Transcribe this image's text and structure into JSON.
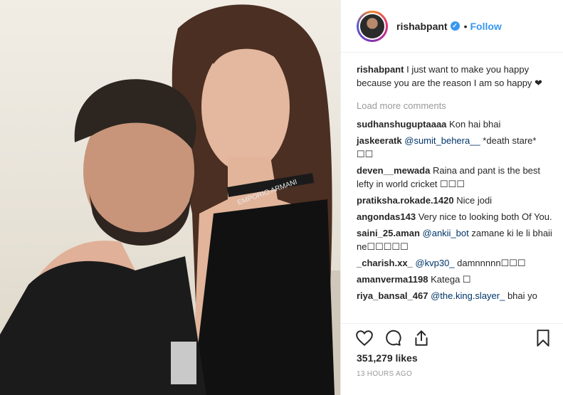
{
  "post": {
    "username": "rishabpant",
    "verified_icon": "verified-badge-icon",
    "separator": "•",
    "follow_label": "Follow",
    "caption": {
      "username": "rishabpant",
      "text": "I just want to make you happy because you are the reason I am so happy ❤"
    },
    "load_more_label": "Load more comments",
    "comments": [
      {
        "username": "sudhanshuguptaaaa",
        "text": "Kon hai bhai"
      },
      {
        "username": "jaskeeratk",
        "mention": "@sumit_behera__",
        "text": " *death stare* ☐☐"
      },
      {
        "username": "deven__mewada",
        "text": "Raina and pant is the best lefty in world cricket ☐☐☐"
      },
      {
        "username": "pratiksha.rokade.1420",
        "text": "Nice jodi"
      },
      {
        "username": "angondas143",
        "text": "Very nice to looking both Of You."
      },
      {
        "username": "saini_25.aman",
        "mention": "@ankii_bot",
        "text": " zamane ki le li bhaii ne☐☐☐☐☐"
      },
      {
        "username": "_charish.xx_",
        "mention": "@kvp30_",
        "text": " damnnnnn☐☐☐"
      },
      {
        "username": "amanverma1198",
        "text": "Katega ☐"
      },
      {
        "username": "riya_bansal_467",
        "mention": "@the.king.slayer_",
        "text": " bhai yo"
      }
    ],
    "likes": "351,279 likes",
    "timestamp": "13 HOURS AGO",
    "photo_overlay_text": "EMPORIO ARMANI",
    "icons": {
      "like": "heart-icon",
      "comment": "comment-icon",
      "share": "share-icon",
      "save": "bookmark-icon"
    },
    "colors": {
      "link_blue": "#3897f0",
      "text": "#262626",
      "muted": "#999999",
      "mention": "#003569"
    }
  }
}
